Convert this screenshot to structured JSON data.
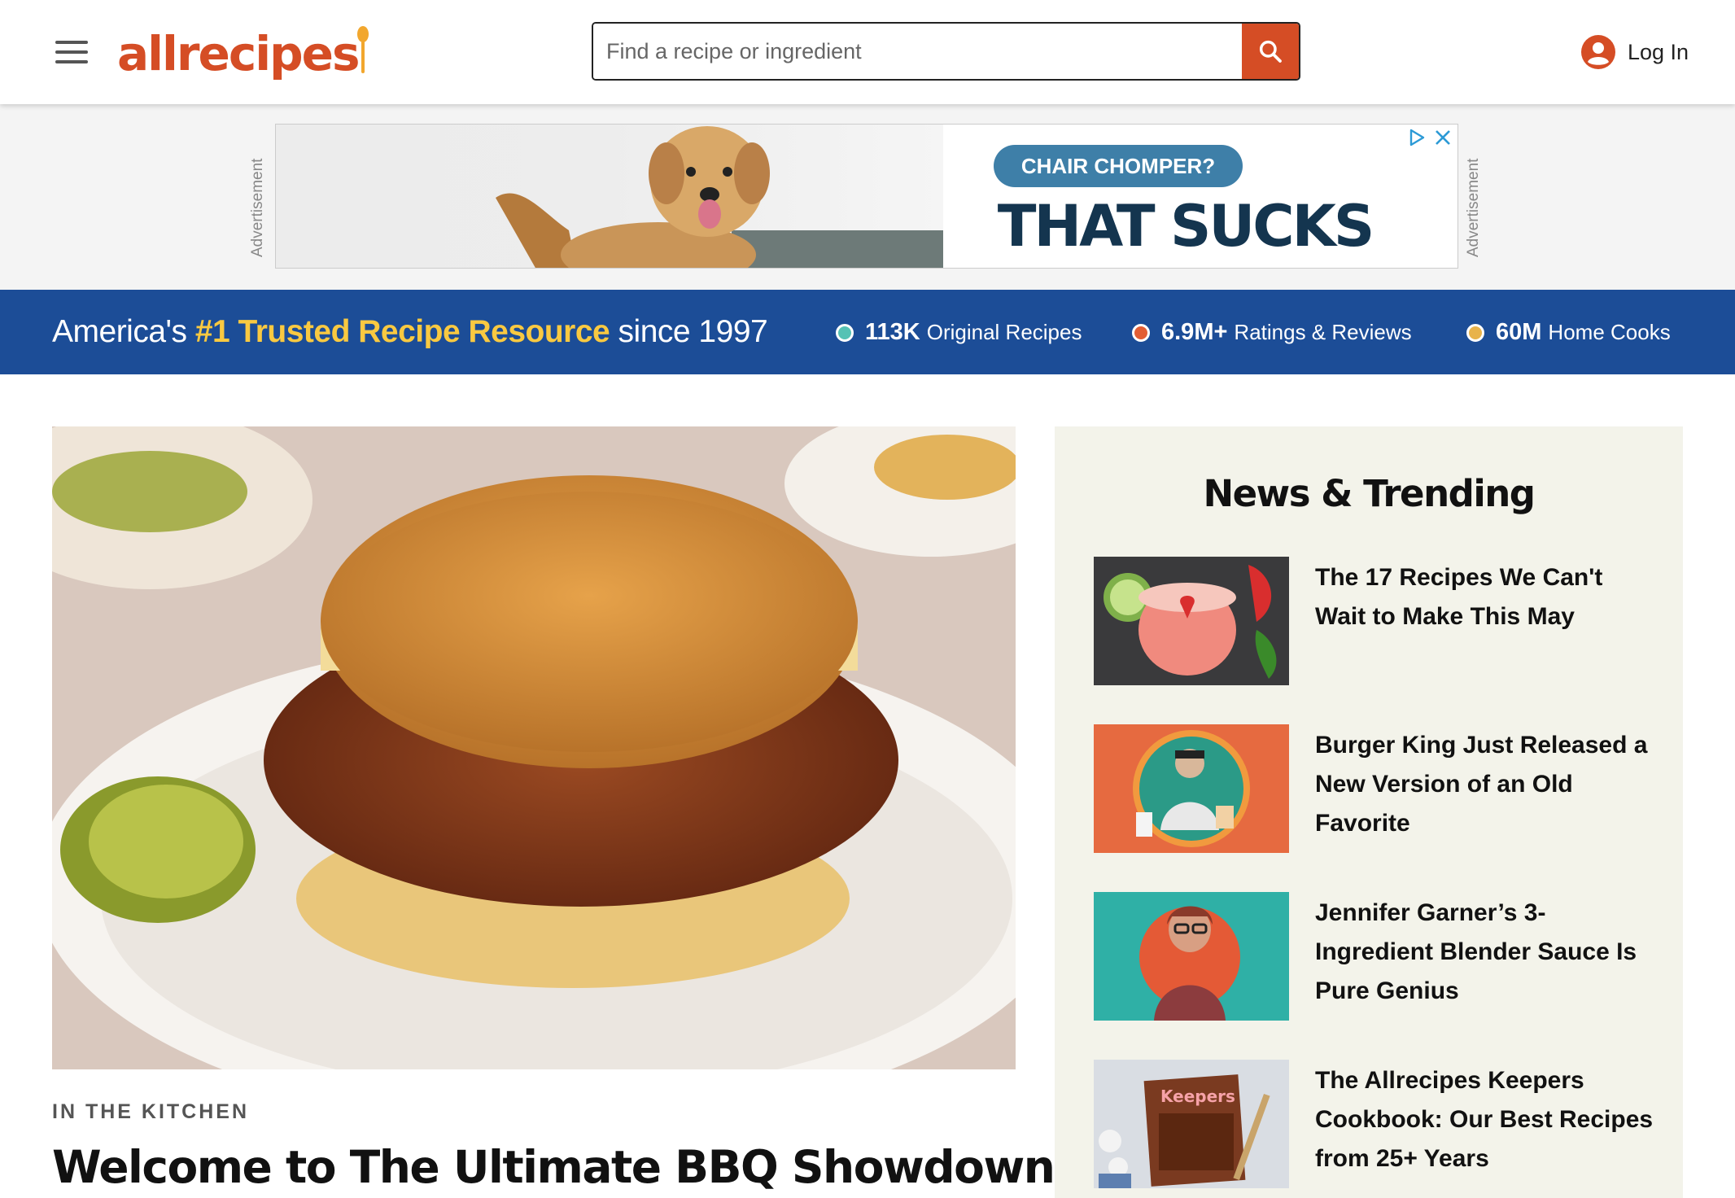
{
  "header": {
    "logo_text": "allrecipes",
    "search_placeholder": "Find a recipe or ingredient",
    "login_label": "Log In",
    "brand_color": "#d54d25"
  },
  "ad": {
    "label": "Advertisement",
    "pill": "CHAIR CHOMPER?",
    "headline": "THAT SUCKS"
  },
  "trust_bar": {
    "prefix": "America's ",
    "highlight": "#1 Trusted Recipe Resource",
    "suffix": " since 1997",
    "stats": [
      {
        "value": "113K",
        "label": "Original Recipes",
        "color": "#55c2b4"
      },
      {
        "value": "6.9M+",
        "label": "Ratings & Reviews",
        "color": "#e25d34"
      },
      {
        "value": "60M",
        "label": "Home Cooks",
        "color": "#e8b34b"
      }
    ]
  },
  "hero": {
    "kicker": "IN THE KITCHEN",
    "title": "Welcome to The Ultimate BBQ Showdown"
  },
  "news": {
    "title": "News & Trending",
    "items": [
      {
        "title": "The 17 Recipes We Can't Wait to Make This May"
      },
      {
        "title": "Burger King Just Released a New Version of an Old Favorite"
      },
      {
        "title": "Jennifer Garner’s 3-Ingredient Blender Sauce Is Pure Genius"
      },
      {
        "title": "The Allrecipes Keepers Cookbook: Our Best Recipes from 25+ Years"
      }
    ],
    "cookbook_cover_text": "Keepers"
  }
}
